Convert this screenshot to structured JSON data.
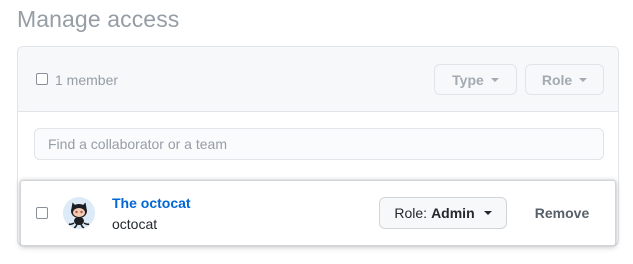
{
  "page": {
    "title": "Manage access"
  },
  "header": {
    "member_count": "1 member",
    "type_filter_label": "Type",
    "role_filter_label": "Role"
  },
  "search": {
    "placeholder": "Find a collaborator or a team",
    "value": ""
  },
  "members": [
    {
      "display_name": "The octocat",
      "login": "octocat",
      "role_prefix": "Role:",
      "role_value": "Admin",
      "remove_label": "Remove",
      "avatar_icon": "octocat-avatar"
    }
  ],
  "colors": {
    "link": "#0366d6",
    "muted": "#959da5",
    "border": "#e1e4e8"
  }
}
